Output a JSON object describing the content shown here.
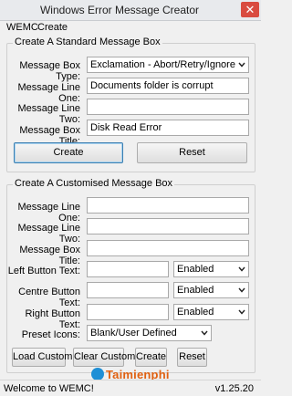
{
  "window": {
    "title": "Windows Error Message Creator",
    "close_glyph": "✕"
  },
  "menu": {
    "items": [
      "WEMC",
      "Create"
    ]
  },
  "standard": {
    "group_title": "Create A Standard Message Box",
    "type_label": "Message Box Type:",
    "type_value": "Exclamation - Abort/Retry/Ignore",
    "line1_label": "Message Line One:",
    "line1_value": "Documents folder is corrupt",
    "line2_label": "Message Line Two:",
    "line2_value": "",
    "title_label": "Message Box Title:",
    "title_value": "Disk Read Error",
    "create_label": "Create",
    "reset_label": "Reset"
  },
  "custom": {
    "group_title": "Create A Customised Message Box",
    "line1_label": "Message Line One:",
    "line1_value": "",
    "line2_label": "Message Line Two:",
    "line2_value": "",
    "title_label": "Message Box Title:",
    "title_value": "",
    "left_label": "Left Button Text:",
    "left_value": "",
    "left_state": "Enabled",
    "centre_label": "Centre Button Text:",
    "centre_value": "",
    "centre_state": "Enabled",
    "right_label": "Right Button Text:",
    "right_value": "",
    "right_state": "Enabled",
    "icons_label": "Preset Icons:",
    "icons_value": "Blank/User Defined",
    "load_label": "Load Custom",
    "clear_label": "Clear Custom",
    "create_label": "Create",
    "reset_label": "Reset"
  },
  "status": {
    "left": "Welcome to WEMC!",
    "right": "v1.25.20"
  },
  "watermark": {
    "text": "Taimienphi"
  },
  "icons": {
    "dropdown": "chevron-down-icon",
    "close": "close-icon"
  },
  "colors": {
    "close_button": "#d94b3f",
    "focus_border": "#3c7fb1",
    "watermark": "#e06010"
  }
}
